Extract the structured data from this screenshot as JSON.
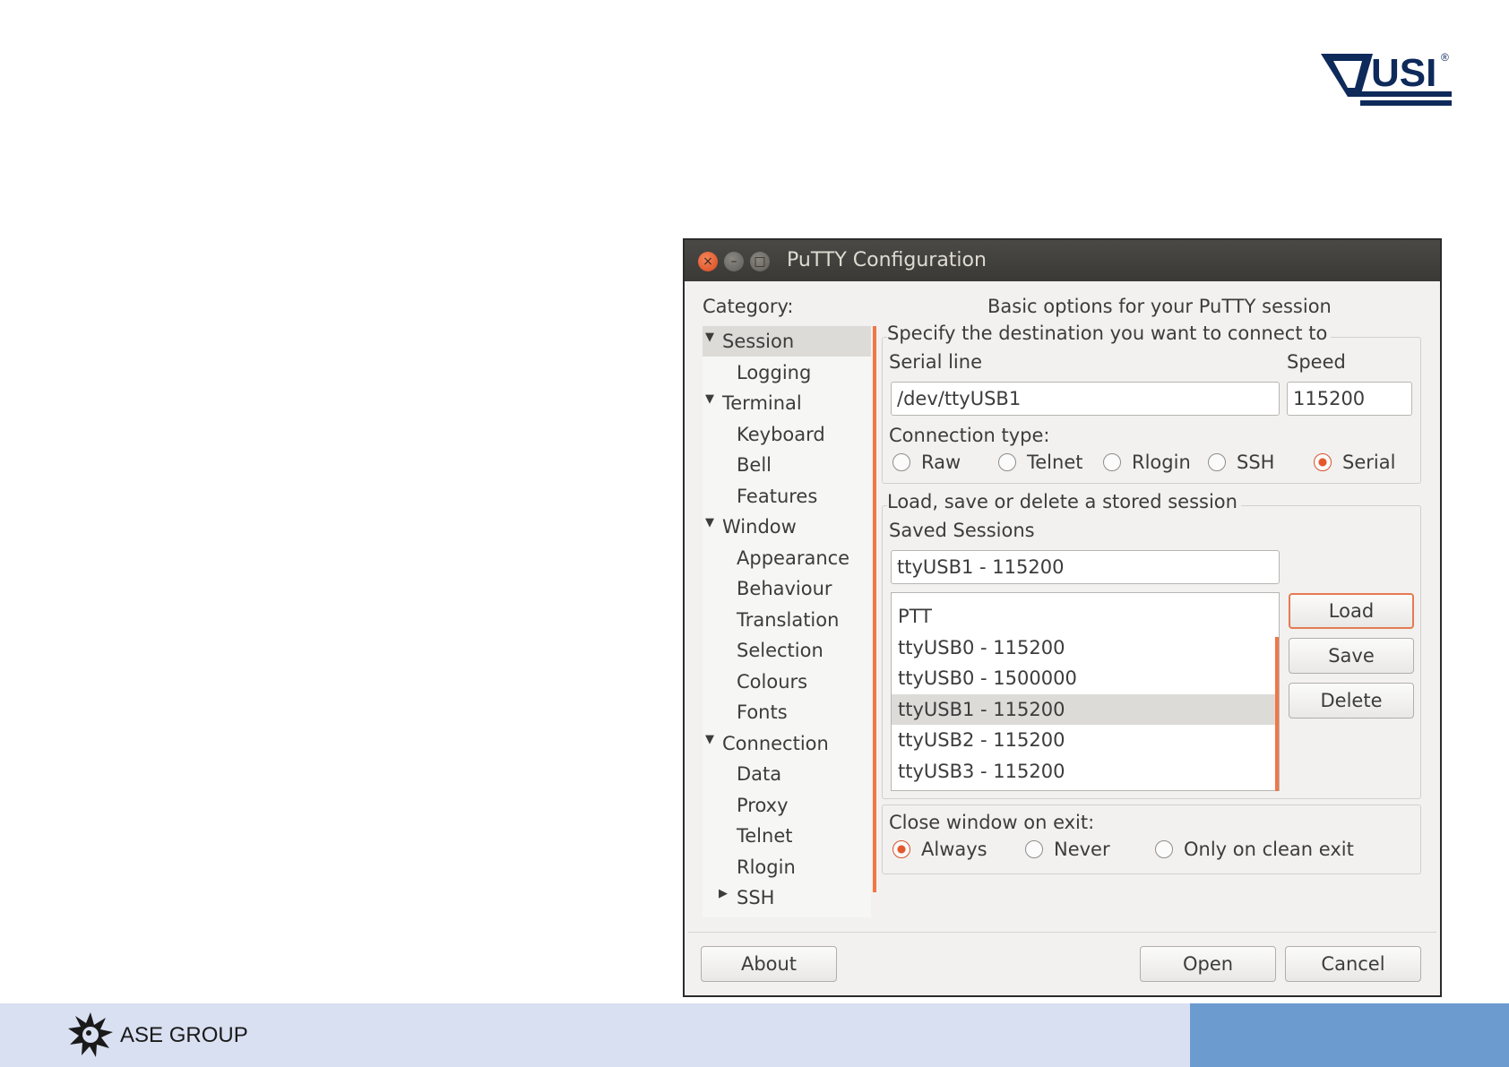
{
  "slide": {
    "logo_text": "USI",
    "logo_mark": "®",
    "footer_text": "ASE GROUP",
    "colors": {
      "footer_band": "#d9e0f2",
      "footer_accent": "#6b9bcf",
      "logo_navy": "#0e2a5a"
    }
  },
  "window": {
    "title": "PuTTY Configuration",
    "controls": {
      "close": "×",
      "minimize": "–",
      "maximize": "□"
    },
    "category_label": "Category:",
    "panel_title": "Basic options for your PuTTY session",
    "tree": [
      {
        "label": "Session",
        "expander": "▼",
        "selected": true
      },
      {
        "label": "Logging"
      },
      {
        "label": "Terminal",
        "expander": "▼"
      },
      {
        "label": "Keyboard"
      },
      {
        "label": "Bell"
      },
      {
        "label": "Features"
      },
      {
        "label": "Window",
        "expander": "▼"
      },
      {
        "label": "Appearance"
      },
      {
        "label": "Behaviour"
      },
      {
        "label": "Translation"
      },
      {
        "label": "Selection"
      },
      {
        "label": "Colours"
      },
      {
        "label": "Fonts"
      },
      {
        "label": "Connection",
        "expander": "▼"
      },
      {
        "label": "Data"
      },
      {
        "label": "Proxy"
      },
      {
        "label": "Telnet"
      },
      {
        "label": "Rlogin"
      },
      {
        "label": "SSH",
        "expander": "▶"
      }
    ],
    "destination": {
      "group_title": "Specify the destination you want to connect to",
      "serial_line_label": "Serial line",
      "speed_label": "Speed",
      "serial_line_value": "/dev/ttyUSB1",
      "speed_value": "115200",
      "connection_type_label": "Connection type:",
      "connection_types": [
        {
          "label": "Raw",
          "checked": false
        },
        {
          "label": "Telnet",
          "checked": false
        },
        {
          "label": "Rlogin",
          "checked": false
        },
        {
          "label": "SSH",
          "checked": false
        },
        {
          "label": "Serial",
          "checked": true
        }
      ]
    },
    "sessions": {
      "group_title": "Load, save or delete a stored session",
      "saved_sessions_label": "Saved Sessions",
      "session_name_value": "ttyUSB1 - 115200",
      "list": [
        {
          "label": "PTT",
          "selected": false
        },
        {
          "label": "ttyUSB0 - 115200",
          "selected": false
        },
        {
          "label": "ttyUSB0 - 1500000",
          "selected": false
        },
        {
          "label": "ttyUSB1 - 115200",
          "selected": true
        },
        {
          "label": "ttyUSB2 - 115200",
          "selected": false
        },
        {
          "label": "ttyUSB3 - 115200",
          "selected": false
        }
      ],
      "load_label": "Load",
      "save_label": "Save",
      "delete_label": "Delete"
    },
    "close_on_exit": {
      "label": "Close window on exit:",
      "options": [
        {
          "label": "Always",
          "checked": true
        },
        {
          "label": "Never",
          "checked": false
        },
        {
          "label": "Only on clean exit",
          "checked": false
        }
      ]
    },
    "footer": {
      "about_label": "About",
      "open_label": "Open",
      "cancel_label": "Cancel"
    }
  }
}
